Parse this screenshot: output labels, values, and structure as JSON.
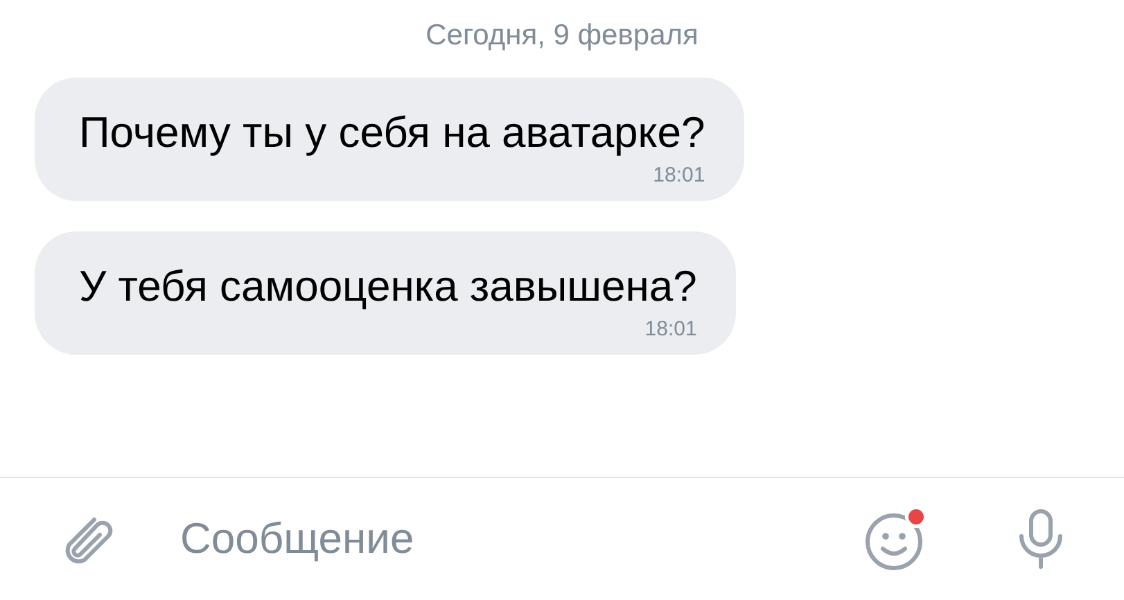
{
  "date_separator": "Сегодня, 9 февраля",
  "messages": [
    {
      "text": "Почему ты у себя на аватарке?",
      "time": "18:01"
    },
    {
      "text": "У тебя самооценка завышена?",
      "time": "18:01"
    }
  ],
  "composer": {
    "placeholder": "Сообщение"
  }
}
